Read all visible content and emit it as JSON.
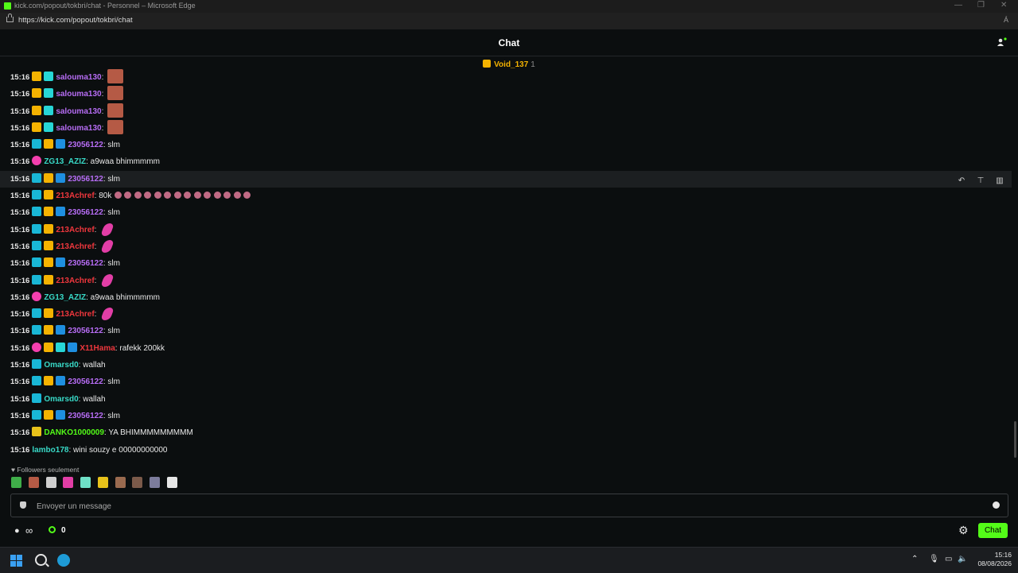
{
  "window": {
    "title": "kick.com/popout/tokbri/chat - Personnel – Microsoft Edge",
    "url": "https://kick.com/popout/tokbri/chat",
    "minimize": "—",
    "restore": "❐",
    "close": "✕",
    "read_aloud": "Á"
  },
  "header": {
    "title": "Chat"
  },
  "pinned": {
    "gifter": "Void_137",
    "count": "1"
  },
  "colors": {
    "accent": "#53fc18",
    "purple": "#b76df5",
    "teal": "#38d9c7",
    "red": "#f0373d"
  },
  "messages": [
    {
      "time": "15:16",
      "user": "salouma130",
      "text": "",
      "color": "#b76df5"
    },
    {
      "time": "15:16",
      "user": "salouma130",
      "text": "",
      "color": "#b76df5"
    },
    {
      "time": "15:16",
      "user": "salouma130",
      "text": "",
      "color": "#b76df5"
    },
    {
      "time": "15:16",
      "user": "salouma130",
      "text": "",
      "color": "#b76df5"
    },
    {
      "time": "15:16",
      "user": "23056122",
      "text": "slm",
      "color": "#b76df5"
    },
    {
      "time": "15:16",
      "user": "ZG13_AZIZ",
      "text": "a9waa bhimmmmm",
      "color": "#38d9c7"
    },
    {
      "time": "15:16",
      "user": "23056122",
      "text": "slm",
      "color": "#b76df5"
    },
    {
      "time": "15:16",
      "user": "213Achref",
      "text": "80k",
      "color": "#f0373d"
    },
    {
      "time": "15:16",
      "user": "23056122",
      "text": "slm",
      "color": "#b76df5"
    },
    {
      "time": "15:16",
      "user": "213Achref",
      "text": "",
      "color": "#f0373d"
    },
    {
      "time": "15:16",
      "user": "213Achref",
      "text": "",
      "color": "#f0373d"
    },
    {
      "time": "15:16",
      "user": "23056122",
      "text": "slm",
      "color": "#b76df5"
    },
    {
      "time": "15:16",
      "user": "213Achref",
      "text": "",
      "color": "#f0373d"
    },
    {
      "time": "15:16",
      "user": "ZG13_AZIZ",
      "text": "a9waa bhimmmmm",
      "color": "#38d9c7"
    },
    {
      "time": "15:16",
      "user": "213Achref",
      "text": "",
      "color": "#f0373d"
    },
    {
      "time": "15:16",
      "user": "23056122",
      "text": "slm",
      "color": "#b76df5"
    },
    {
      "time": "15:16",
      "user": "X11Hama",
      "text": "rafekk 200kk",
      "color": "#f0373d"
    },
    {
      "time": "15:16",
      "user": "Omarsd0",
      "text": "wallah",
      "color": "#38d9c7"
    },
    {
      "time": "15:16",
      "user": "23056122",
      "text": "slm",
      "color": "#b76df5"
    },
    {
      "time": "15:16",
      "user": "Omarsd0",
      "text": "wallah",
      "color": "#38d9c7"
    },
    {
      "time": "15:16",
      "user": "23056122",
      "text": "slm",
      "color": "#b76df5"
    },
    {
      "time": "15:16",
      "user": "DANKO1000009",
      "text": "YA BHIMMMMMMMMM",
      "color": "#53fc18"
    },
    {
      "time": "15:16",
      "user": "lambo178",
      "text": "wini souzy e 00000000000",
      "color": "#38d9c7"
    }
  ],
  "footer": {
    "followers_mode": "♥ Followers seulement",
    "input_placeholder": "Envoyer un message",
    "infinity": "∞",
    "points": "0",
    "send_label": "Chat"
  },
  "taskbar": {
    "time": "15:16",
    "date": "08/08/2026"
  }
}
